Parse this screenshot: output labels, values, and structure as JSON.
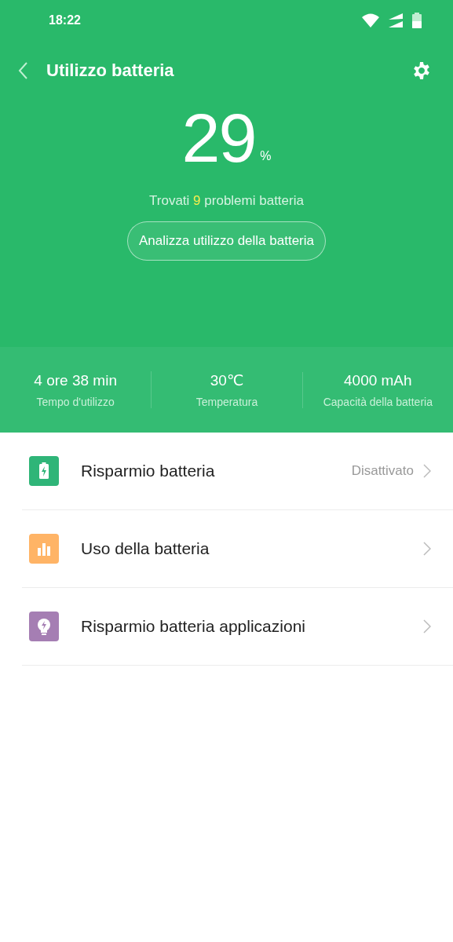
{
  "status_bar": {
    "time": "18:22"
  },
  "header": {
    "title": "Utilizzo batteria"
  },
  "battery": {
    "percent": "29",
    "unit": "%"
  },
  "issues": {
    "before": "Trovati",
    "count": "9",
    "after": "problemi batteria"
  },
  "analyze_button": "Analizza utilizzo della batteria",
  "stats": [
    {
      "value": "4 ore 38 min",
      "label": "Tempo d'utilizzo"
    },
    {
      "value": "30℃",
      "label": "Temperatura"
    },
    {
      "value": "4000 mAh",
      "label": "Capacità della batteria"
    }
  ],
  "items": [
    {
      "kind": "battery",
      "color": "#2fb578",
      "label": "Risparmio batteria",
      "value": "Disattivato"
    },
    {
      "kind": "chart",
      "color": "#ffb466",
      "label": "Uso della batteria"
    },
    {
      "kind": "bulb",
      "color": "#a57eb3",
      "label": "Risparmio batteria applicazioni"
    }
  ]
}
